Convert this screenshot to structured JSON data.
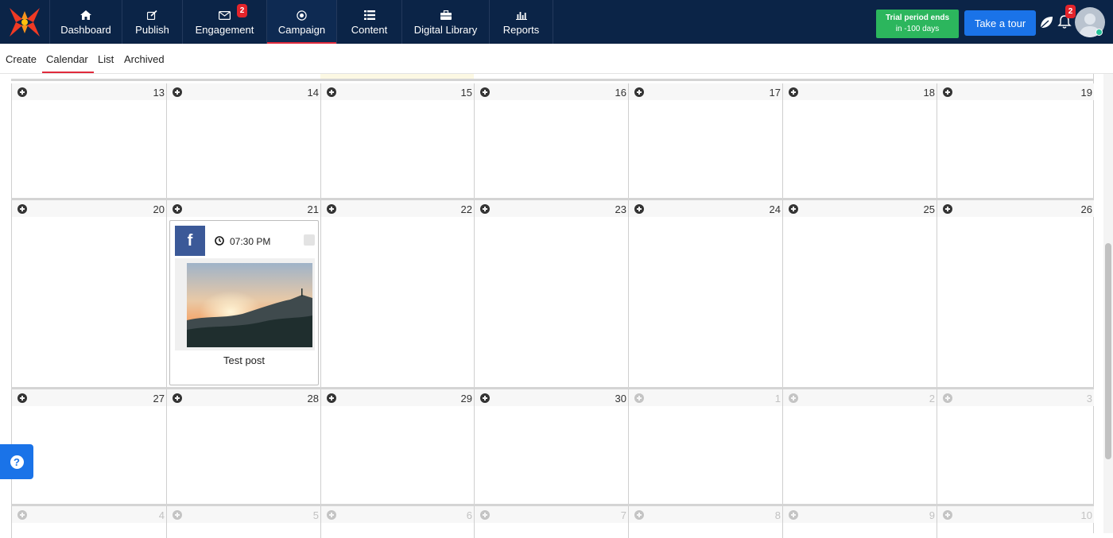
{
  "nav": {
    "items": [
      {
        "label": "Dashboard",
        "icon": "home-icon"
      },
      {
        "label": "Publish",
        "icon": "edit-icon"
      },
      {
        "label": "Engagement",
        "icon": "envelope-icon",
        "badge": "2"
      },
      {
        "label": "Campaign",
        "icon": "target-icon"
      },
      {
        "label": "Content",
        "icon": "list-icon"
      },
      {
        "label": "Digital Library",
        "icon": "briefcase-icon"
      },
      {
        "label": "Reports",
        "icon": "bar-chart-icon"
      }
    ],
    "active": "Campaign"
  },
  "header": {
    "trial_line1": "Trial period ends",
    "trial_line2": "in -100 days",
    "tour_label": "Take a tour",
    "notification_badge": "2"
  },
  "subnav": {
    "items": [
      "Create",
      "Calendar",
      "List",
      "Archived"
    ],
    "active": "Calendar"
  },
  "calendar": {
    "weeks": [
      [
        {
          "day": "13"
        },
        {
          "day": "14"
        },
        {
          "day": "15"
        },
        {
          "day": "16"
        },
        {
          "day": "17"
        },
        {
          "day": "18"
        },
        {
          "day": "19"
        }
      ],
      [
        {
          "day": "20"
        },
        {
          "day": "21"
        },
        {
          "day": "22"
        },
        {
          "day": "23"
        },
        {
          "day": "24"
        },
        {
          "day": "25"
        },
        {
          "day": "26"
        }
      ],
      [
        {
          "day": "27"
        },
        {
          "day": "28"
        },
        {
          "day": "29"
        },
        {
          "day": "30"
        },
        {
          "day": "1",
          "other": true
        },
        {
          "day": "2",
          "other": true
        },
        {
          "day": "3",
          "other": true
        }
      ],
      [
        {
          "day": "4",
          "other": true
        },
        {
          "day": "5",
          "other": true
        },
        {
          "day": "6",
          "other": true
        },
        {
          "day": "7",
          "other": true
        },
        {
          "day": "8",
          "other": true
        },
        {
          "day": "9",
          "other": true
        },
        {
          "day": "10",
          "other": true
        }
      ]
    ],
    "post": {
      "network": "facebook",
      "network_glyph": "f",
      "time": "07:30 PM",
      "title": "Test post"
    }
  },
  "colors": {
    "nav_bg": "#0b2447",
    "accent_red": "#e02a3b",
    "trial_green": "#2cb65d",
    "tour_blue": "#1a73e8",
    "facebook": "#3b5998"
  }
}
